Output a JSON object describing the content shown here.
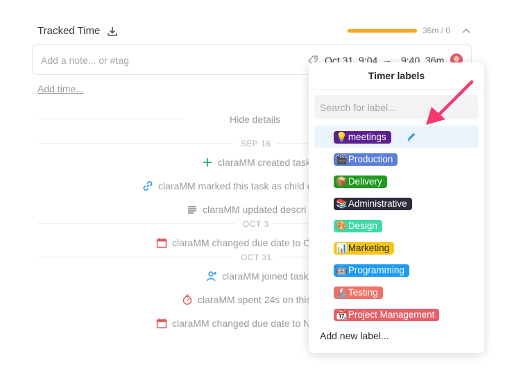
{
  "header": {
    "title": "Tracked Time",
    "time_summary": "36m / 0",
    "progress_fraction": 1.0,
    "progress_color": "#f6a623"
  },
  "note_entry": {
    "placeholder": "Add a note... or #tag",
    "start": "Oct 31, 9:04",
    "arrow": "→",
    "end": "9:40",
    "duration": "36m"
  },
  "add_time_label": "Add time...",
  "hide_details_label": "Hide details",
  "date_separators": [
    "SEP 16",
    "OCT 3",
    "OCT 31"
  ],
  "activity": [
    {
      "icon": "plus-icon",
      "text": "claraMM created task",
      "color": "#1aaf6b"
    },
    {
      "icon": "link-icon",
      "text": "claraMM marked this task as child o",
      "color": "#2196f3"
    },
    {
      "icon": "lines-icon",
      "text": "claraMM updated descri",
      "color": "#666666"
    },
    {
      "icon": "calendar-icon",
      "text": "claraMM changed due date to O",
      "color": "#e05b5b"
    },
    {
      "icon": "user-add-icon",
      "text": "claraMM joined task",
      "color": "#2196f3"
    },
    {
      "icon": "timer-icon",
      "text": "claraMM spent 24s on this",
      "color": "#e05b5b"
    },
    {
      "icon": "calendar-icon",
      "text": "claraMM changed due date to N",
      "color": "#e05b5b"
    }
  ],
  "timer_labels": {
    "title": "Timer labels",
    "search_placeholder": "Search for label...",
    "add_new": "Add new label...",
    "labels": [
      {
        "emoji": "💡",
        "name": "meetings",
        "color": "#5b1f8f",
        "selected": true
      },
      {
        "emoji": "🎬",
        "name": "Production",
        "color": "#5b7fd8",
        "selected": false
      },
      {
        "emoji": "📦",
        "name": "Delivery",
        "color": "#1f9a1f",
        "selected": false
      },
      {
        "emoji": "📚",
        "name": "Administrative",
        "color": "#2c2c3a",
        "selected": false
      },
      {
        "emoji": "🎨",
        "name": "Design",
        "color": "#3ed9a6",
        "selected": false
      },
      {
        "emoji": "📊",
        "name": "Marketing",
        "color": "#f5c518",
        "selected": false
      },
      {
        "emoji": "🤖",
        "name": "Programming",
        "color": "#1d9bf0",
        "selected": false
      },
      {
        "emoji": "🔬",
        "name": "Testing",
        "color": "#f07167",
        "selected": false
      },
      {
        "emoji": "📆",
        "name": "Project Management",
        "color": "#e4606a",
        "selected": false
      }
    ]
  },
  "accent_color": "#2196f3",
  "annotation_arrow_color": "#f2386c"
}
